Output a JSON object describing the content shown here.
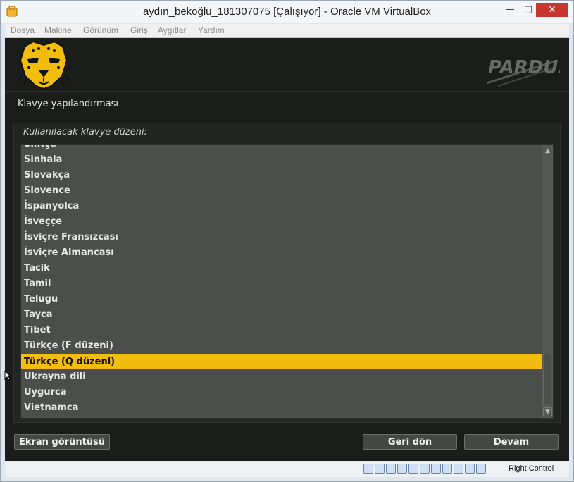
{
  "window": {
    "title": "aydın_bekoğlu_181307075 [Çalışıyor] - Oracle VM VirtualBox",
    "min_glyph": "—",
    "max_glyph": "□",
    "close_glyph": "✕"
  },
  "menubar": [
    "Dosya",
    "Makine",
    "Görünüm",
    "Giriş",
    "Aygıtlar",
    "Yardım"
  ],
  "installer": {
    "section_title": "Klavye yapılandırması",
    "panel_label": "Kullanılacak klavye düzeni:",
    "layouts": [
      "Sintçe",
      "Sinhala",
      "Slovakça",
      "Slovence",
      "İspanyolca",
      "İsveççe",
      "İsviçre Fransızcası",
      "İsviçre Almancası",
      "Tacik",
      "Tamil",
      "Telugu",
      "Tayca",
      "Tibet",
      "Türkçe (F düzeni)",
      "Türkçe (Q düzeni)",
      "Ukrayna dili",
      "Uygurca",
      "Vietnamca"
    ],
    "selected_layout": "Türkçe (Q düzeni)",
    "buttons": {
      "screenshot": "Ekran görüntüsü",
      "back": "Geri dön",
      "next": "Devam"
    },
    "colors": {
      "selected": "#f2bd0c",
      "background": "#1b1d1b"
    }
  },
  "statusbar": {
    "host_key": "Right Control"
  }
}
